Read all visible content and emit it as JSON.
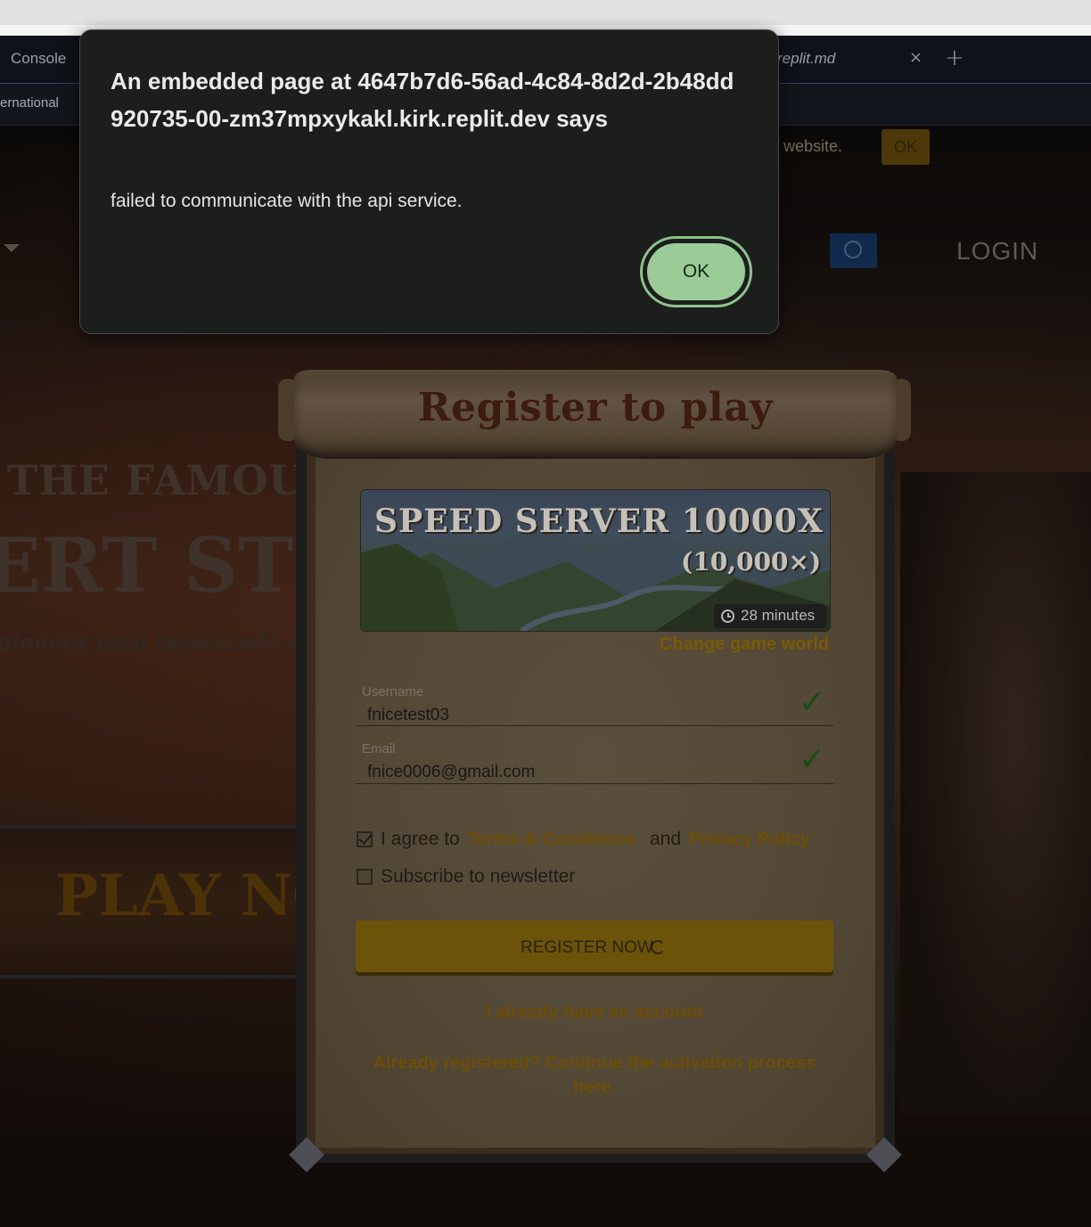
{
  "browser": {
    "tabs": [
      {
        "label": "Console"
      },
      {
        "label": "replit.md"
      }
    ],
    "tab_close": "×",
    "new_tab": "+",
    "address_fragment": "ernational"
  },
  "site": {
    "cookie_text": "r website.",
    "cookie_ok": "OK",
    "login": "LOGIN",
    "hero": {
      "line1": "THE FAMOUS",
      "line2": "ERT STRA",
      "tagline": "pioneer with thousands of"
    },
    "play_now": "PLAY NO"
  },
  "register": {
    "title": "Register to play",
    "world": {
      "name": "SPEED SERVER 10000X",
      "speed": "(10,000×)",
      "time": "28 minutes"
    },
    "change_world": "Change game world",
    "username": {
      "label": "Username",
      "value": "fnicetest03"
    },
    "email": {
      "label": "Email",
      "value": "fnice0006@gmail.com"
    },
    "agree_text": "I agree to",
    "terms_link": "Terms & Conditions",
    "and_text": "and",
    "privacy_link": "Privacy Policy",
    "newsletter": "Subscribe to newsletter",
    "agree_checked": true,
    "newsletter_checked": false,
    "register_button": "REGISTER NOW",
    "have_account": "I already have an account",
    "activation": "Already registered? Continue the activation process here."
  },
  "alert": {
    "title": "An embedded page at 4647b7d6-56ad-4c84-8d2d-2b48dd920735-00-zm37mpxykakl.kirk.replit.dev says",
    "message": "failed to communicate with the api service.",
    "ok": "OK"
  },
  "colors": {
    "accent_gold": "#6c530a",
    "alert_button": "#9bcc98",
    "check_green": "#1d4a18"
  }
}
